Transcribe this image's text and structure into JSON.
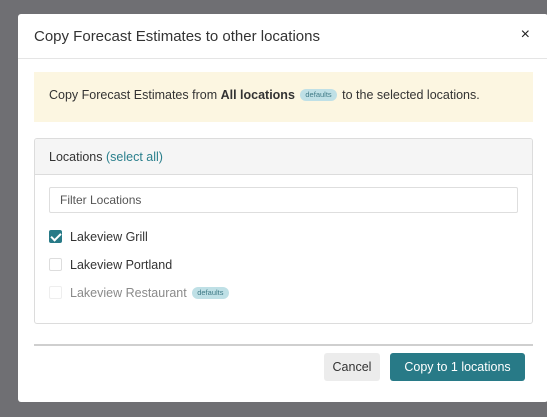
{
  "modal": {
    "title": "Copy Forecast Estimates to other locations",
    "close_glyph": "×"
  },
  "banner": {
    "prefix": "Copy Forecast Estimates from ",
    "source": "All locations",
    "badge": "defaults",
    "suffix": " to the selected locations."
  },
  "locations": {
    "header_label": "Locations",
    "select_all": "(select all)",
    "filter_placeholder": "Filter Locations",
    "filter_value": "",
    "items": [
      {
        "label": "Lakeview Grill",
        "checked": true,
        "disabled": false,
        "badge": ""
      },
      {
        "label": "Lakeview Portland",
        "checked": false,
        "disabled": false,
        "badge": ""
      },
      {
        "label": "Lakeview Restaurant",
        "checked": false,
        "disabled": true,
        "badge": "defaults"
      }
    ]
  },
  "footer": {
    "cancel_label": "Cancel",
    "copy_label": "Copy to 1 locations"
  },
  "colors": {
    "accent": "#287a87",
    "banner_bg": "#fcf6e1",
    "badge_bg": "#bfe0e6",
    "overlay": "#6f6f73"
  },
  "icons": {
    "close": "close-icon",
    "checkbox_checked": "checkmark-icon"
  }
}
